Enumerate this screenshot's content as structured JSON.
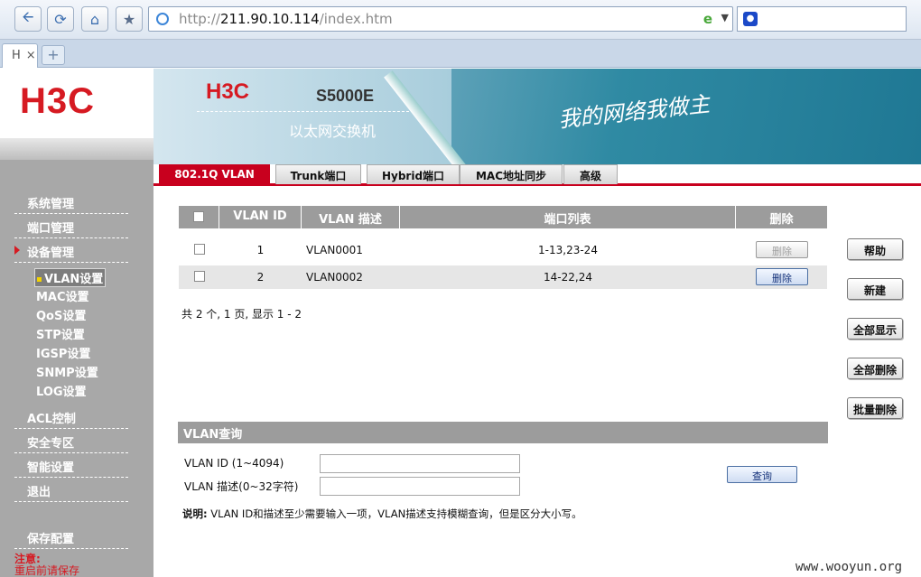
{
  "browser": {
    "address": {
      "prefix": "http://",
      "host": "211.90.10.114",
      "path": "/index.htm"
    },
    "tab_label": "H",
    "tab_close": "×",
    "new_tab": "+"
  },
  "app": {
    "logo": "H3C",
    "banner": {
      "brand": "H3C",
      "model": "S5000E",
      "type": "以太网交换机",
      "slogan": "我的网络我做主"
    }
  },
  "sidebar": {
    "items": [
      {
        "label": "系统管理"
      },
      {
        "label": "端口管理"
      },
      {
        "label": "设备管理"
      }
    ],
    "sub_items": [
      {
        "label": "VLAN设置"
      },
      {
        "label": "MAC设置"
      },
      {
        "label": "QoS设置"
      },
      {
        "label": "STP设置"
      },
      {
        "label": "IGSP设置"
      },
      {
        "label": "SNMP设置"
      },
      {
        "label": "LOG设置"
      }
    ],
    "items2": [
      {
        "label": "ACL控制"
      },
      {
        "label": "安全专区"
      },
      {
        "label": "智能设置"
      },
      {
        "label": "退出"
      }
    ],
    "save": "保存配置",
    "note_title": "注意:",
    "note_text": "重启前请保存"
  },
  "tabs": [
    {
      "label": "802.1Q VLAN"
    },
    {
      "label": "Trunk端口"
    },
    {
      "label": "Hybrid端口"
    },
    {
      "label": "MAC地址同步"
    },
    {
      "label": "高级"
    }
  ],
  "table": {
    "headers": [
      "VLAN ID",
      "VLAN 描述",
      "端口列表",
      "删除"
    ],
    "rows": [
      {
        "id": "1",
        "desc": "VLAN0001",
        "ports": "1-13,23-24",
        "delete": "删除",
        "delete_enabled": false
      },
      {
        "id": "2",
        "desc": "VLAN0002",
        "ports": "14-22,24",
        "delete": "删除",
        "delete_enabled": true
      }
    ],
    "summary": "共 2 个, 1 页, 显示  1 - 2"
  },
  "actions": [
    {
      "label": "帮助"
    },
    {
      "label": "新建"
    },
    {
      "label": "全部显示"
    },
    {
      "label": "全部删除"
    },
    {
      "label": "批量删除"
    }
  ],
  "query": {
    "title": "VLAN查询",
    "id_label": "VLAN ID (1~4094)",
    "id_value": "",
    "desc_label": "VLAN 描述(0~32字符)",
    "desc_value": "",
    "button": "查询",
    "tip_label": "说明:",
    "tip_text": "VLAN ID和描述至少需要输入一项，VLAN描述支持模糊查询，但是区分大小写。"
  },
  "watermark": "www.wooyun.org"
}
